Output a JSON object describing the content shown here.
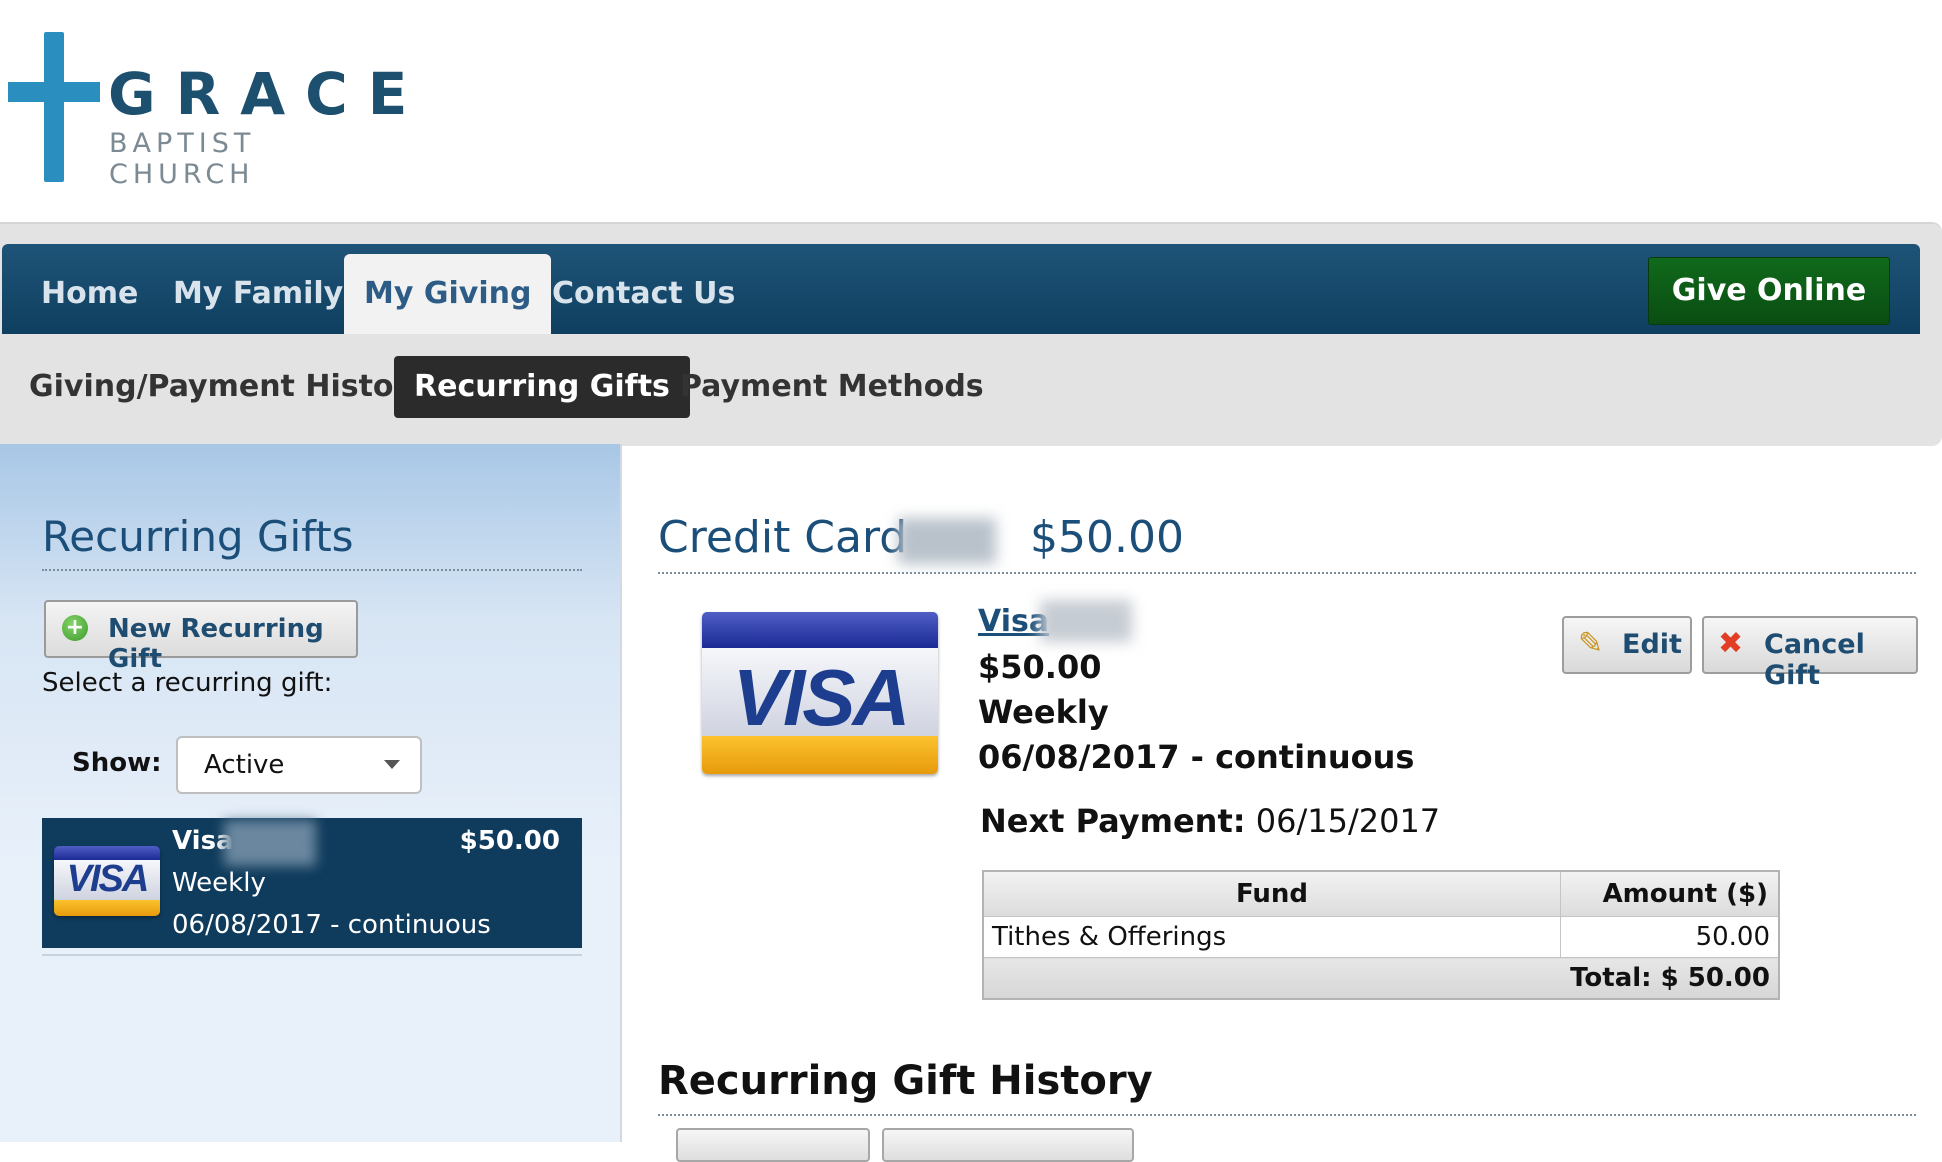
{
  "logo": {
    "title": "GRACE",
    "subtitle": "BAPTIST CHURCH"
  },
  "nav": {
    "items": [
      "Home",
      "My Family",
      "My Giving",
      "Contact Us"
    ],
    "active": "My Giving",
    "give_online": "Give Online"
  },
  "subnav": {
    "items": [
      "Giving/Payment History",
      "Recurring Gifts",
      "Payment Methods"
    ],
    "active": "Recurring Gifts"
  },
  "sidebar": {
    "title": "Recurring Gifts",
    "new_button": "New Recurring Gift",
    "select_label": "Select a recurring gift:",
    "show_label": "Show:",
    "show_value": "Active",
    "gift": {
      "card": "Visa",
      "amount": "$50.00",
      "frequency": "Weekly",
      "dates": "06/08/2017 - continuous"
    }
  },
  "main": {
    "title": "Credit Card",
    "title_amount": "$50.00",
    "card_link": "Visa",
    "amount": "$50.00",
    "frequency": "Weekly",
    "dates": "06/08/2017 - continuous",
    "next_payment_label": "Next Payment:",
    "next_payment_date": "06/15/2017",
    "edit_button": "Edit",
    "cancel_button": "Cancel Gift",
    "table": {
      "headers": [
        "Fund",
        "Amount ($)"
      ],
      "rows": [
        [
          "Tithes & Offerings",
          "50.00"
        ]
      ],
      "total": "Total: $ 50.00"
    },
    "history_title": "Recurring Gift History"
  },
  "card_brand_text": "VISA",
  "colors": {
    "nav": "#164a6d",
    "give_button": "#0b5413",
    "accent": "#1b4f79"
  }
}
